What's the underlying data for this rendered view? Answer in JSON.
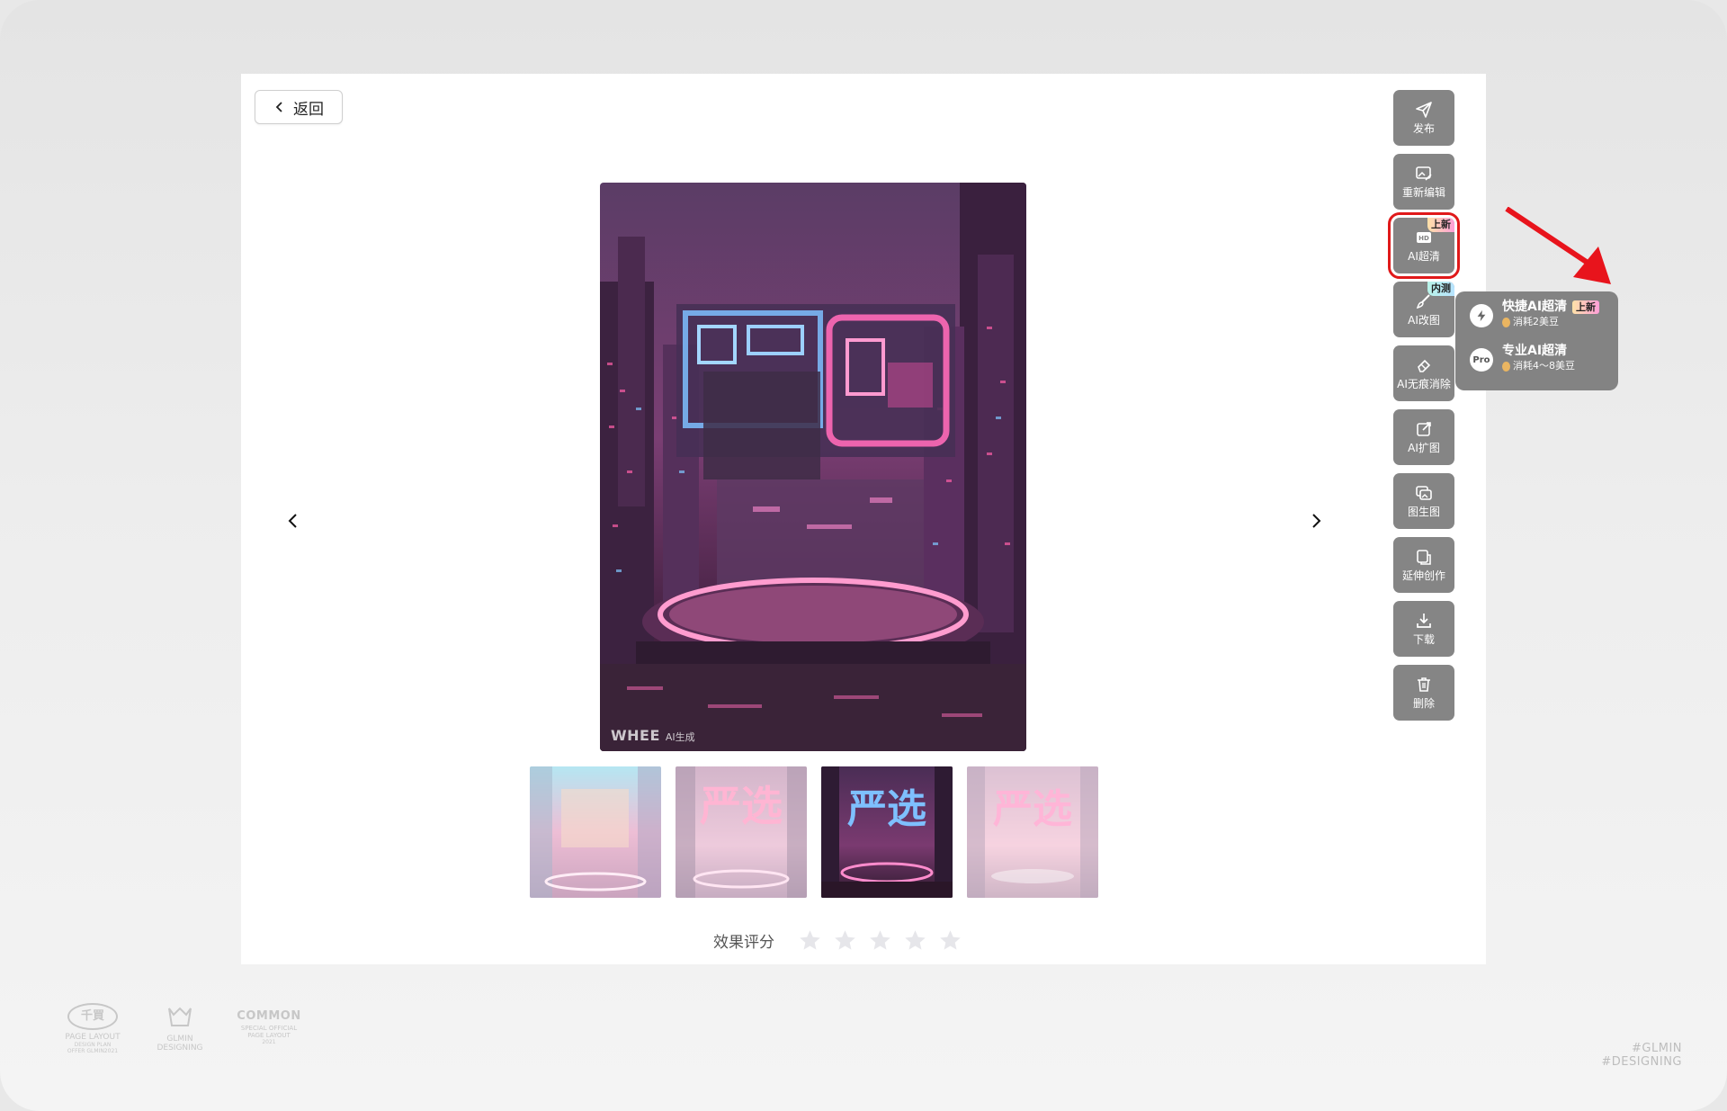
{
  "back": {
    "label": "返回"
  },
  "image": {
    "watermark_brand": "WHEE",
    "watermark_sub": "AI生成",
    "poster_text": "严选"
  },
  "toolbar": [
    {
      "label": "发布",
      "icon": "send-icon"
    },
    {
      "label": "重新编辑",
      "icon": "image-edit-icon"
    },
    {
      "label": "AI超清",
      "icon": "hd-icon",
      "badge": "上新",
      "selected": true
    },
    {
      "label": "AI改图",
      "icon": "brush-icon",
      "badge": "内测"
    },
    {
      "label": "AI无痕消除",
      "icon": "eraser-icon"
    },
    {
      "label": "AI扩图",
      "icon": "expand-icon"
    },
    {
      "label": "图生图",
      "icon": "image-to-image-icon"
    },
    {
      "label": "延伸创作",
      "icon": "extend-icon"
    },
    {
      "label": "下载",
      "icon": "download-icon"
    },
    {
      "label": "删除",
      "icon": "trash-icon"
    }
  ],
  "upscale_menu": [
    {
      "title": "快捷AI超清",
      "tag": "上新",
      "cost": "消耗2美豆",
      "icon": "lightning-icon"
    },
    {
      "title": "专业AI超清",
      "icon_text": "Pro",
      "cost": "消耗4～8美豆"
    }
  ],
  "rating": {
    "label": "效果评分",
    "stars": 5,
    "value": 0
  },
  "footer": {
    "logo1": {
      "mark": "千買",
      "line1": "PAGE LAYOUT",
      "line2": "DESIGN PLAN",
      "line3": "OFFER GLMIN2021"
    },
    "logo2": {
      "line1": "GLMIN",
      "line2": "DESIGNING"
    },
    "logo3": {
      "mark": "COMMON",
      "line1": "SPECIAL OFFICIAL",
      "line2": "PAGE LAYOUT",
      "line3": "2021"
    },
    "tags": [
      "#GLMIN",
      "#DESIGNING"
    ]
  },
  "colors": {
    "tool_bg": "#858585",
    "highlight": "#e0191a",
    "arrow": "#e8141c"
  }
}
